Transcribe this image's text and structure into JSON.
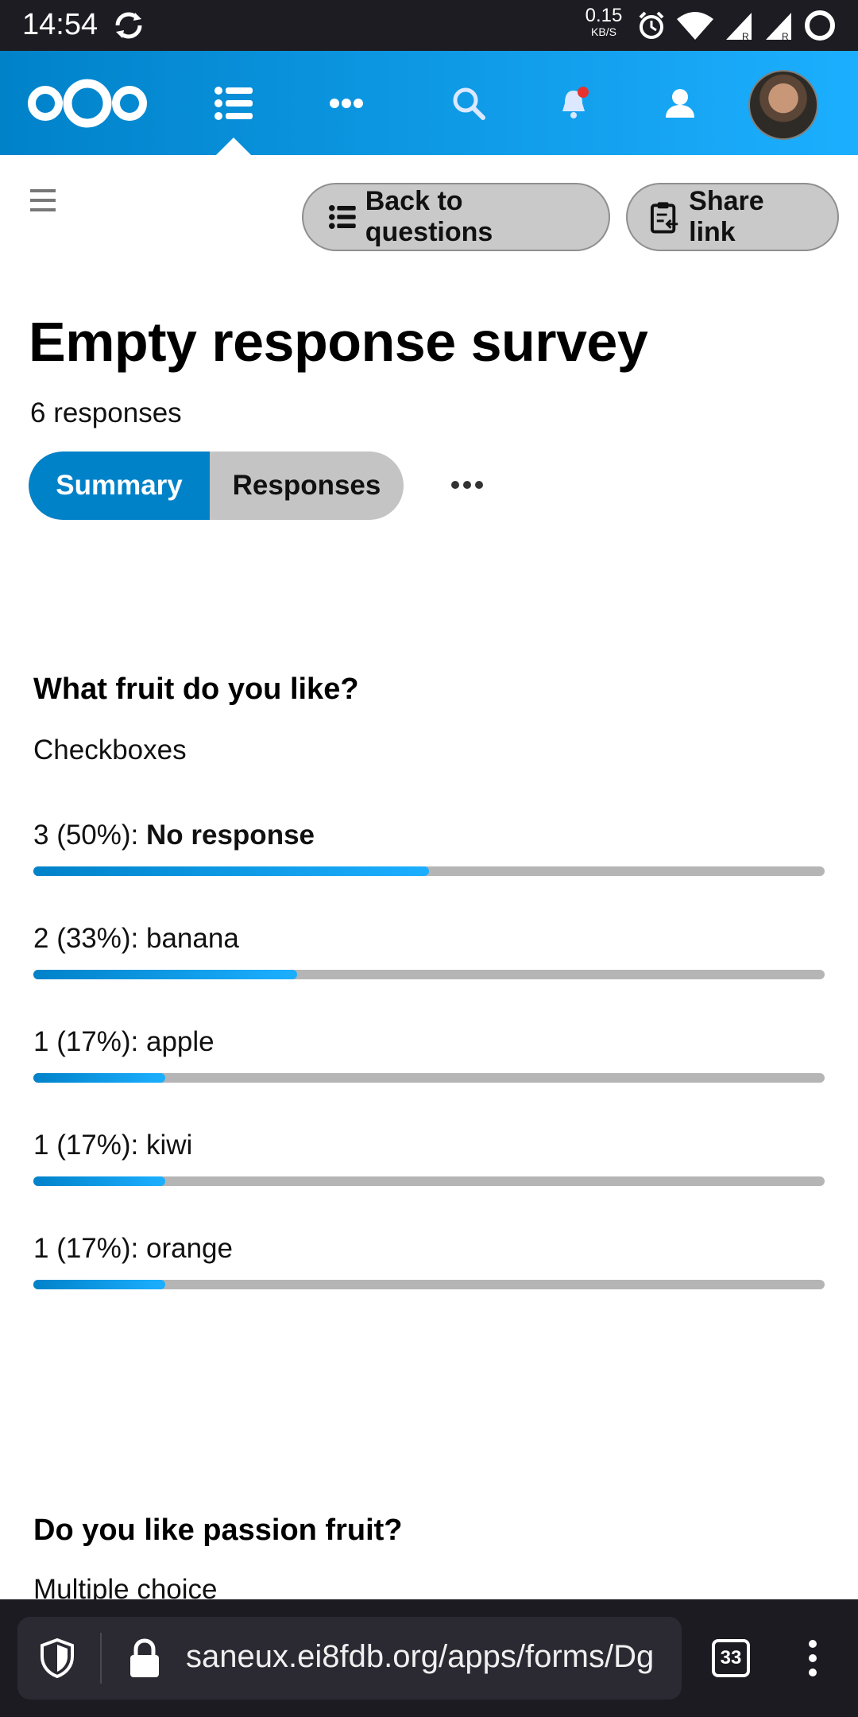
{
  "status_bar": {
    "time": "14:54",
    "net_speed": "0.15",
    "net_unit": "KB/S"
  },
  "header": {
    "icons": [
      "nextcloud-logo-icon",
      "forms-list-icon",
      "more-apps-icon",
      "search-icon",
      "notifications-icon",
      "contacts-icon",
      "avatar"
    ],
    "accent": "#0082c9",
    "accent_light": "#1cafff",
    "notification_dot": "#e9322d"
  },
  "toolbar": {
    "back_label": "Back to questions",
    "share_label": "Share link"
  },
  "form": {
    "title": "Empty response survey",
    "responses_count": "6 responses"
  },
  "tabs": {
    "summary": "Summary",
    "responses": "Responses",
    "active": "Summary"
  },
  "questions": [
    {
      "title": "What fruit do you like?",
      "type": "Checkboxes",
      "answers": [
        {
          "prefix": "3 (50%): ",
          "label": "No response",
          "fraction": 0.5,
          "bold": true
        },
        {
          "prefix": "2 (33%): ",
          "label": "banana",
          "fraction": 0.333,
          "bold": false
        },
        {
          "prefix": "1 (17%): ",
          "label": "apple",
          "fraction": 0.167,
          "bold": false
        },
        {
          "prefix": "1 (17%): ",
          "label": "kiwi",
          "fraction": 0.167,
          "bold": false
        },
        {
          "prefix": "1 (17%): ",
          "label": "orange",
          "fraction": 0.167,
          "bold": false
        }
      ]
    },
    {
      "title": "Do you like passion fruit?",
      "type": "Multiple choice"
    }
  ],
  "browser": {
    "url": "saneux.ei8fdb.org/apps/forms/Dg",
    "tab_count": "33"
  }
}
